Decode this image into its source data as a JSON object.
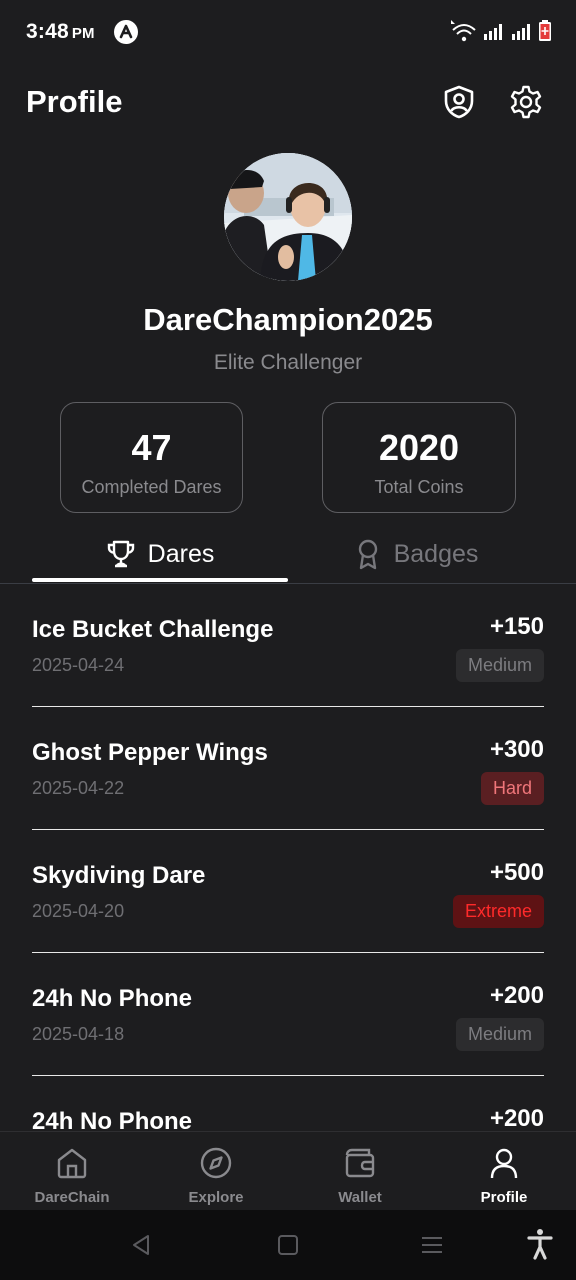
{
  "status_bar": {
    "time": "3:48",
    "ampm": "PM",
    "icons": [
      "app-notification-icon",
      "wifi-icon",
      "signal-icon",
      "signal-icon",
      "battery-icon"
    ]
  },
  "header": {
    "title": "Profile",
    "icons": [
      "shield-user-icon",
      "gear-icon"
    ]
  },
  "profile": {
    "username": "DareChampion2025",
    "rank": "Elite Challenger"
  },
  "stats": [
    {
      "value": "47",
      "label": "Completed Dares"
    },
    {
      "value": "2020",
      "label": "Total Coins"
    }
  ],
  "tabs": [
    {
      "label": "Dares",
      "icon": "trophy-icon",
      "active": true
    },
    {
      "label": "Badges",
      "icon": "award-icon",
      "active": false
    }
  ],
  "dares": [
    {
      "title": "Ice Bucket Challenge",
      "date": "2025-04-24",
      "reward": "+150",
      "difficulty": "Medium"
    },
    {
      "title": "Ghost Pepper Wings",
      "date": "2025-04-22",
      "reward": "+300",
      "difficulty": "Hard"
    },
    {
      "title": "Skydiving Dare",
      "date": "2025-04-20",
      "reward": "+500",
      "difficulty": "Extreme"
    },
    {
      "title": "24h No Phone",
      "date": "2025-04-18",
      "reward": "+200",
      "difficulty": "Medium"
    },
    {
      "title": "24h No Phone",
      "date": "",
      "reward": "+200",
      "difficulty": ""
    }
  ],
  "difficulty_colors": {
    "Medium": {
      "bg": "#2c2c2e",
      "fg": "#7c7c80"
    },
    "Hard": {
      "bg": "#5a1f22",
      "fg": "#f0767a"
    },
    "Extreme": {
      "bg": "#5e1214",
      "fg": "#ff2a2a"
    }
  },
  "bottom_nav": [
    {
      "label": "DareChain",
      "icon": "home-icon",
      "active": false
    },
    {
      "label": "Explore",
      "icon": "compass-icon",
      "active": false
    },
    {
      "label": "Wallet",
      "icon": "wallet-icon",
      "active": false
    },
    {
      "label": "Profile",
      "icon": "user-icon",
      "active": true
    }
  ],
  "system_nav": [
    "back-icon",
    "home-square-icon",
    "recents-icon",
    "accessibility-icon"
  ]
}
